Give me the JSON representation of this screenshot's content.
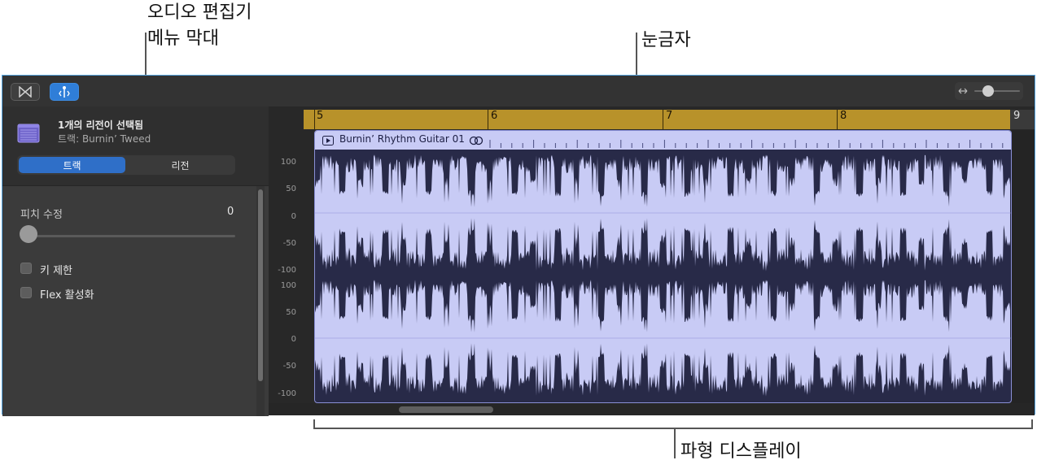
{
  "callouts": {
    "menubar_line1": "오디오 편집기",
    "menubar_line2": "메뉴 막대",
    "ruler": "눈금자",
    "waveform": "파형 디스플레이"
  },
  "inspector": {
    "title": "1개의 리전이 선택됨",
    "subtitle": "트랙: Burnin’ Tweed",
    "tabs": [
      "트랙",
      "리전"
    ],
    "pitch_label": "피치 수정",
    "pitch_value": "0",
    "pitch_fraction": 0,
    "key_limit_label": "키 제한",
    "flex_label": "Flex 활성화"
  },
  "ruler": {
    "bars": [
      "5",
      "6",
      "7",
      "8",
      "9"
    ]
  },
  "region": {
    "name": "Burnin’ Rhythm Guitar 01"
  },
  "axis": {
    "upper": [
      "100",
      "50",
      "0",
      "-50",
      "-100"
    ],
    "lower": [
      "100",
      "50",
      "0",
      "-50",
      "-100"
    ]
  },
  "colors": {
    "ruler": "#b8922a",
    "waveform": "#c8cbf5",
    "accent": "#2f7ed8",
    "selection_border": "#5aa9e6"
  }
}
